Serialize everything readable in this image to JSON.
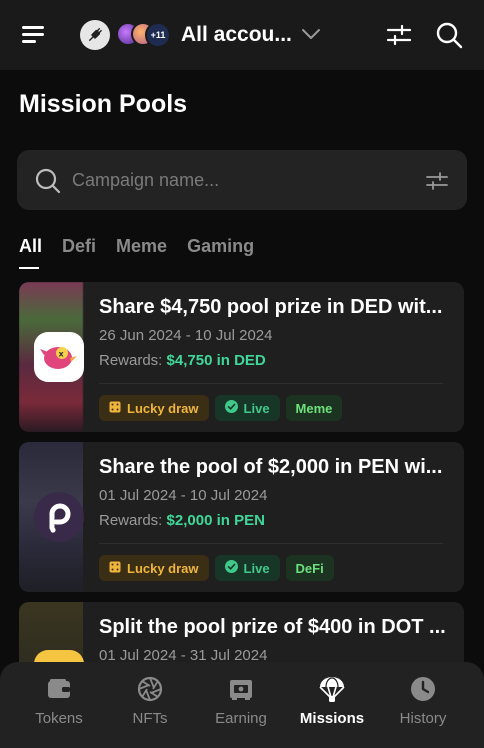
{
  "header": {
    "account_name": "All accou...",
    "avatar_count_label": "+11",
    "icons": [
      "menu-icon",
      "plug-icon",
      "chevron-down-icon",
      "filter-sliders-icon",
      "search-icon"
    ]
  },
  "page": {
    "title": "Mission Pools"
  },
  "search": {
    "placeholder": "Campaign name..."
  },
  "tabs": [
    {
      "label": "All",
      "active": true
    },
    {
      "label": "Defi",
      "active": false
    },
    {
      "label": "Meme",
      "active": false
    },
    {
      "label": "Gaming",
      "active": false
    }
  ],
  "missions": [
    {
      "title": "Share $4,750 pool prize in DED wit...",
      "dates": "26 Jun 2024 - 10 Jul 2024",
      "rewards_label": "Rewards:",
      "rewards_value": "$4,750 in DED",
      "tags": [
        "Lucky draw",
        "Live",
        "Meme"
      ]
    },
    {
      "title": "Share the pool of $2,000 in PEN wi...",
      "dates": "01 Jul 2024 - 10 Jul 2024",
      "rewards_label": "Rewards:",
      "rewards_value": "$2,000 in PEN",
      "tags": [
        "Lucky draw",
        "Live",
        "DeFi"
      ]
    },
    {
      "title": "Split the pool prize of $400 in DOT ...",
      "dates": "01 Jul 2024 - 31 Jul 2024"
    }
  ],
  "bottom_nav": [
    {
      "label": "Tokens",
      "icon": "wallet-icon",
      "active": false
    },
    {
      "label": "NFTs",
      "icon": "aperture-icon",
      "active": false
    },
    {
      "label": "Earning",
      "icon": "earning-icon",
      "active": false
    },
    {
      "label": "Missions",
      "icon": "parachute-icon",
      "active": true
    },
    {
      "label": "History",
      "icon": "clock-icon",
      "active": false
    }
  ],
  "colors": {
    "background": "#0c0c0c",
    "card": "#1f1f1f",
    "reward_green": "#3fd89a",
    "lucky_draw": "#f0b53c",
    "live": "#40c98a",
    "category": "#6ce07a"
  }
}
